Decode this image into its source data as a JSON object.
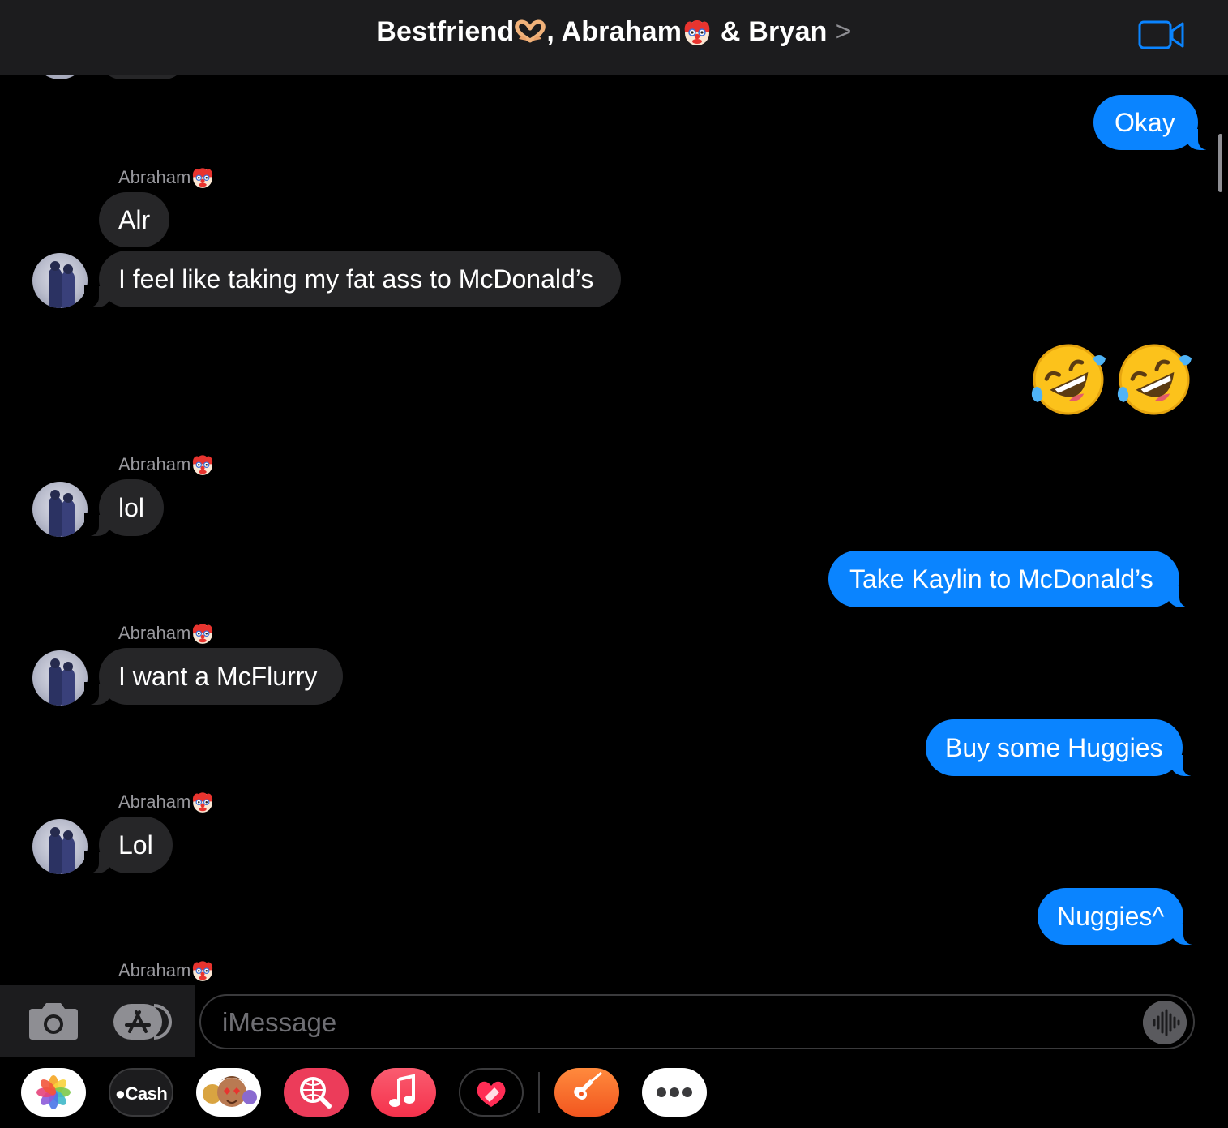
{
  "header": {
    "participant_1": "Bestfriend",
    "separator": ", ",
    "participant_2": "Abraham",
    "participant_3": "& Bryan",
    "chevron": ">"
  },
  "messages": [
    {
      "type": "sent",
      "text": "Okay"
    },
    {
      "type": "sender",
      "text": "Abraham"
    },
    {
      "type": "received",
      "text": "Alr"
    },
    {
      "type": "received",
      "text": "I feel like taking my fat ass to McDonald’s"
    },
    {
      "type": "sent-emoji",
      "text": "🤣🤣"
    },
    {
      "type": "sender",
      "text": "Abraham"
    },
    {
      "type": "received",
      "text": "lol"
    },
    {
      "type": "sent",
      "text": "Take Kaylin to McDonald’s"
    },
    {
      "type": "sender",
      "text": "Abraham"
    },
    {
      "type": "received",
      "text": "I want a McFlurry"
    },
    {
      "type": "sent",
      "text": "Buy some Huggies"
    },
    {
      "type": "sender",
      "text": "Abraham"
    },
    {
      "type": "received",
      "text": "Lol"
    },
    {
      "type": "sent",
      "text": "Nuggies^"
    },
    {
      "type": "sender",
      "text": "Abraham"
    }
  ],
  "compose": {
    "placeholder": "iMessage"
  },
  "apps": [
    {
      "name": "photos-app-icon"
    },
    {
      "name": "cash-app-icon",
      "label": "Cash"
    },
    {
      "name": "memoji-app-icon"
    },
    {
      "name": "images-search-app-icon"
    },
    {
      "name": "music-app-icon"
    },
    {
      "name": "digital-touch-app-icon"
    },
    {
      "name": "garageband-app-icon"
    },
    {
      "name": "more-apps-icon"
    }
  ],
  "colors": {
    "sent_bubble": "#0a84ff",
    "received_bubble": "#262628",
    "header_bg": "#1c1c1e",
    "accent": "#0a84ff"
  }
}
